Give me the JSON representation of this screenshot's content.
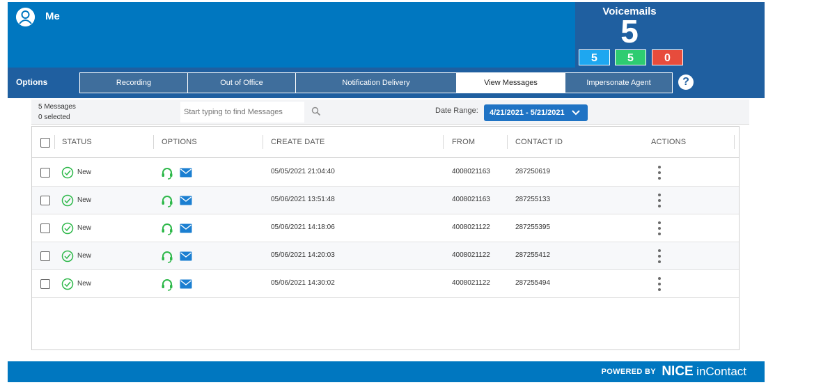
{
  "user": {
    "name": "Me"
  },
  "voicemails": {
    "title": "Voicemails",
    "total": "5",
    "counts": [
      {
        "value": "5",
        "color": "#1ea7f0"
      },
      {
        "value": "5",
        "color": "#2ecc71"
      },
      {
        "value": "0",
        "color": "#e74c3c"
      }
    ]
  },
  "options": {
    "label": "Options",
    "tabs": [
      {
        "label": "Recording"
      },
      {
        "label": "Out of Office"
      },
      {
        "label": "Notification Delivery"
      },
      {
        "label": "View Messages",
        "active": true
      },
      {
        "label": "Impersonate Agent"
      }
    ],
    "help_label": "?"
  },
  "filter": {
    "message_count": "5 Messages",
    "selected_count": "0 selected",
    "search_placeholder": "Start typing to find Messages",
    "date_range_label": "Date Range:",
    "date_range_value": "4/21/2021 - 5/21/2021"
  },
  "table": {
    "headers": {
      "status": "STATUS",
      "options": "OPTIONS",
      "create_date": "CREATE DATE",
      "from": "FROM",
      "contact_id": "CONTACT ID",
      "actions": "ACTIONS"
    },
    "rows": [
      {
        "status": "New",
        "create_date": "05/05/2021 21:04:40",
        "from": "4008021163",
        "contact_id": "287250619"
      },
      {
        "status": "New",
        "create_date": "05/06/2021 13:51:48",
        "from": "4008021163",
        "contact_id": "287255133"
      },
      {
        "status": "New",
        "create_date": "05/06/2021 14:18:06",
        "from": "4008021122",
        "contact_id": "287255395"
      },
      {
        "status": "New",
        "create_date": "05/06/2021 14:20:03",
        "from": "4008021122",
        "contact_id": "287255412"
      },
      {
        "status": "New",
        "create_date": "05/06/2021 14:30:02",
        "from": "4008021122",
        "contact_id": "287255494"
      }
    ]
  },
  "footer": {
    "powered_by": "POWERED BY",
    "brand_nice": "NICE",
    "brand_incontact": "inContact"
  },
  "colors": {
    "header_blue": "#0077c0",
    "options_blue": "#1f5fa0",
    "accent_green": "#2eb84a",
    "mail_blue": "#1b7fd1"
  },
  "icons": [
    "user-avatar-icon",
    "help-icon",
    "search-icon",
    "chevron-down-icon",
    "check-circle-icon",
    "headset-icon",
    "mail-icon",
    "kebab-menu-icon"
  ]
}
